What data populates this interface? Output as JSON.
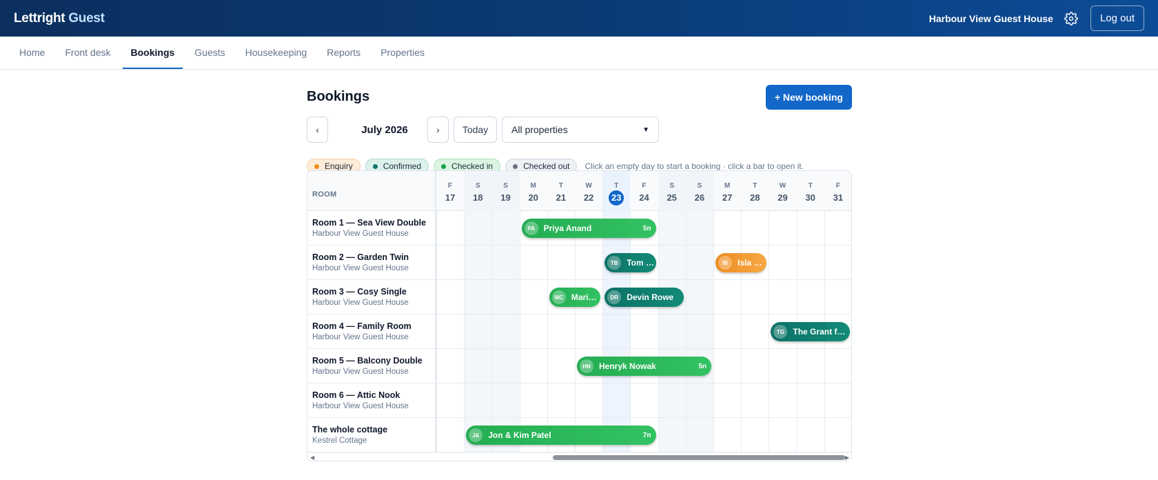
{
  "app": {
    "brand_part1": "Lettright",
    "brand_part2": "Guest"
  },
  "header": {
    "property_name": "Harbour View Guest House",
    "settings_icon": "gear-icon",
    "logout_label": "Log out"
  },
  "nav": {
    "items": [
      "Home",
      "Front desk",
      "Bookings",
      "Guests",
      "Housekeeping",
      "Reports",
      "Properties"
    ],
    "active": "Bookings"
  },
  "page": {
    "title": "Bookings",
    "new_booking_label": "+ New booking",
    "prev_label": "‹",
    "next_label": "›",
    "month_label": "July 2026",
    "today_label": "Today",
    "property_filter": "All properties"
  },
  "legend": {
    "items": [
      {
        "label": "Enquiry",
        "status": "enquiry",
        "color": "#f08c1c"
      },
      {
        "label": "Confirmed",
        "status": "confirmed",
        "color": "#0f766e"
      },
      {
        "label": "Checked in",
        "status": "checkedin",
        "color": "#16a34a"
      },
      {
        "label": "Checked out",
        "status": "checkedout",
        "color": "#6b7280"
      }
    ],
    "hint": "Click an empty day to start a booking · click a bar to open it."
  },
  "calendar": {
    "room_header": "ROOM",
    "days": [
      {
        "dow": "F",
        "num": "17",
        "weekend": false
      },
      {
        "dow": "S",
        "num": "18",
        "weekend": true
      },
      {
        "dow": "S",
        "num": "19",
        "weekend": true
      },
      {
        "dow": "M",
        "num": "20",
        "weekend": false
      },
      {
        "dow": "T",
        "num": "21",
        "weekend": false
      },
      {
        "dow": "W",
        "num": "22",
        "weekend": false
      },
      {
        "dow": "T",
        "num": "23",
        "weekend": false,
        "today": true
      },
      {
        "dow": "F",
        "num": "24",
        "weekend": false
      },
      {
        "dow": "S",
        "num": "25",
        "weekend": true
      },
      {
        "dow": "S",
        "num": "26",
        "weekend": true
      },
      {
        "dow": "M",
        "num": "27",
        "weekend": false
      },
      {
        "dow": "T",
        "num": "28",
        "weekend": false
      },
      {
        "dow": "W",
        "num": "29",
        "weekend": false
      },
      {
        "dow": "T",
        "num": "30",
        "weekend": false
      },
      {
        "dow": "F",
        "num": "31",
        "weekend": false
      }
    ],
    "rooms": [
      {
        "name": "Room 1 — Sea View Double",
        "property": "Harbour View Guest House"
      },
      {
        "name": "Room 2 — Garden Twin",
        "property": "Harbour View Guest House"
      },
      {
        "name": "Room 3 — Cosy Single",
        "property": "Harbour View Guest House"
      },
      {
        "name": "Room 4 — Family Room",
        "property": "Harbour View Guest House"
      },
      {
        "name": "Room 5 — Balcony Double",
        "property": "Harbour View Guest House"
      },
      {
        "name": "Room 6 — Attic Nook",
        "property": "Harbour View Guest House"
      },
      {
        "name": "The whole cottage",
        "property": "Kestrel Cottage"
      }
    ],
    "bookings": [
      {
        "room": 0,
        "start": 3,
        "end": 7,
        "status": "checkedin",
        "initials": "PA",
        "guest": "Priya Anand",
        "nights": "5n"
      },
      {
        "room": 1,
        "start": 6,
        "end": 7,
        "status": "confirmed",
        "initials": "TB",
        "guest": "Tom …",
        "nights": ""
      },
      {
        "room": 1,
        "start": 10,
        "end": 11,
        "status": "enquiry",
        "initials": "IB",
        "guest": "Isla B…",
        "nights": ""
      },
      {
        "room": 2,
        "start": 4,
        "end": 5,
        "status": "checkedin",
        "initials": "MC",
        "guest": "Maris…",
        "nights": ""
      },
      {
        "room": 2,
        "start": 6,
        "end": 8,
        "status": "confirmed",
        "initials": "DR",
        "guest": "Devin Rowe",
        "nights": ""
      },
      {
        "room": 3,
        "start": 12,
        "end": 14,
        "status": "confirmed",
        "initials": "TG",
        "guest": "The Grant fa…",
        "nights": ""
      },
      {
        "room": 4,
        "start": 5,
        "end": 9,
        "status": "checkedin",
        "initials": "HN",
        "guest": "Henryk Nowak",
        "nights": "5n"
      },
      {
        "room": 6,
        "start": 1,
        "end": 7,
        "status": "checkedin",
        "initials": "J&",
        "guest": "Jon & Kim Patel",
        "nights": "7n"
      }
    ]
  }
}
